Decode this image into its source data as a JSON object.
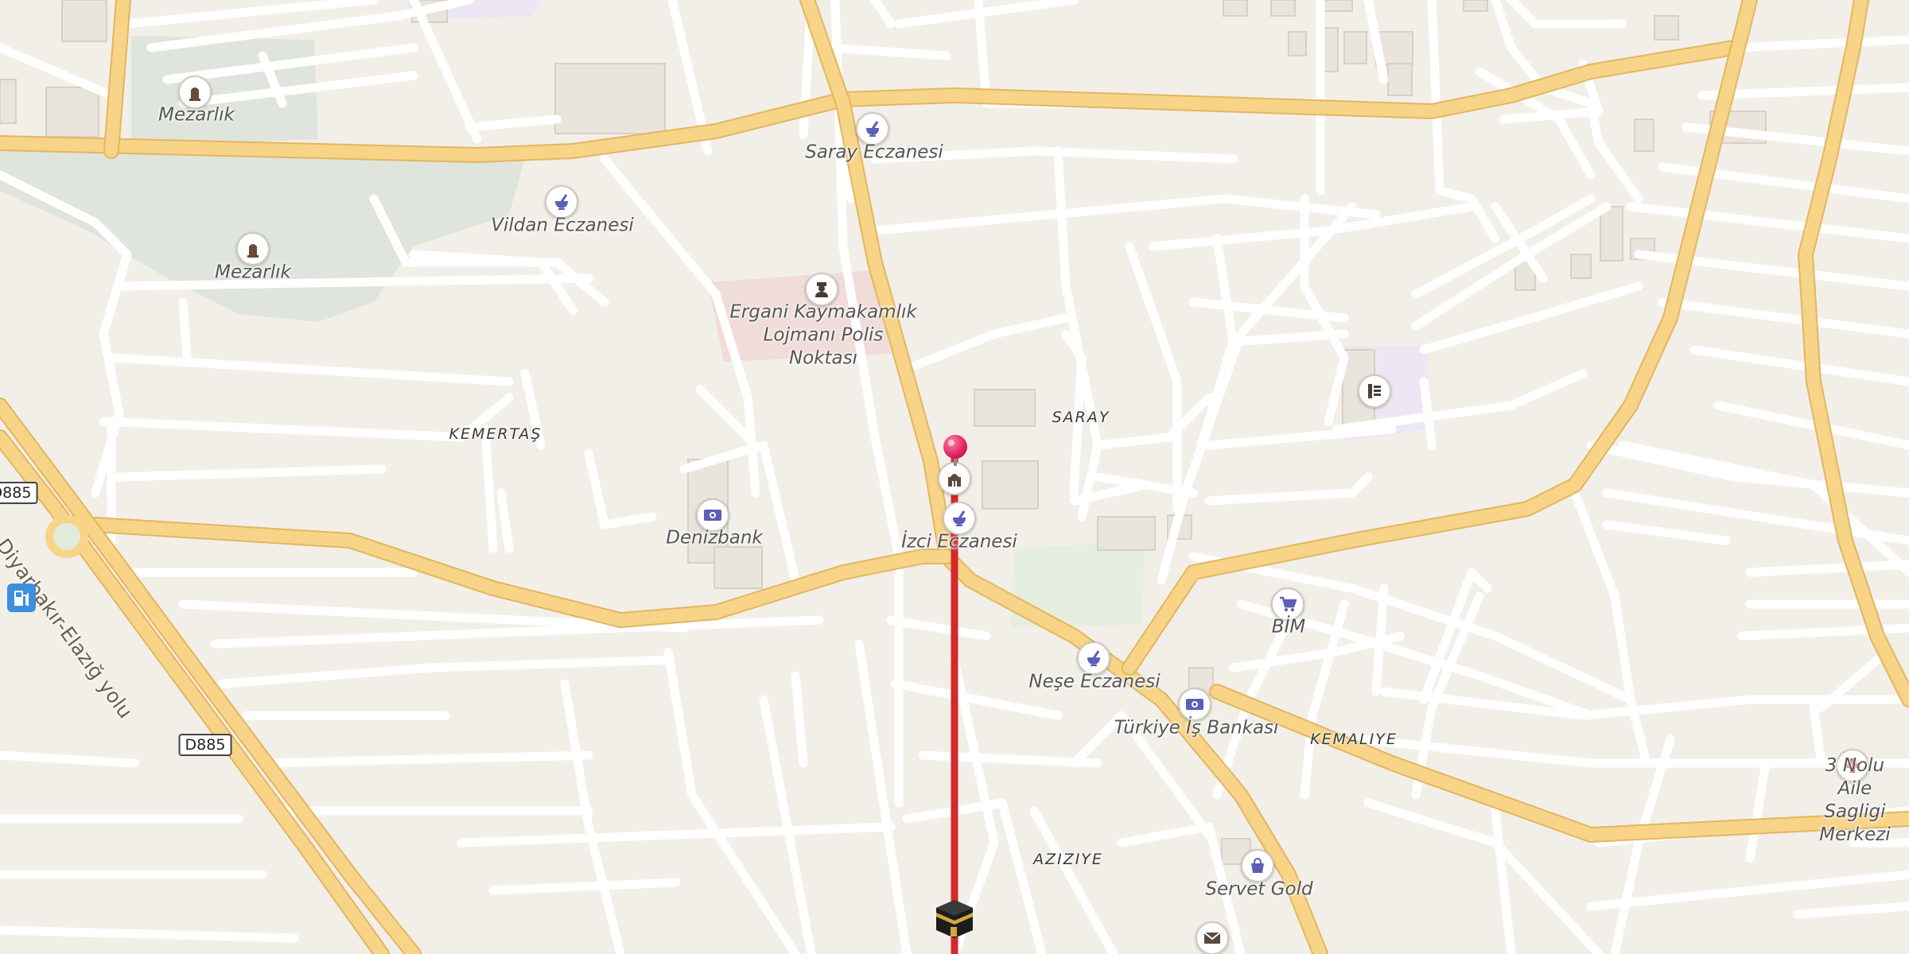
{
  "map": {
    "districts": {
      "kemertas": "KEMERTAŞ",
      "saray": "SARAY",
      "kemaliye": "KEMALIYE",
      "aziziye": "AZIZIYE"
    },
    "road_label": "Diyarbakır-Elazığ yolu",
    "shields": {
      "top": "D885",
      "bottom": "D885"
    },
    "places": {
      "cemetery_1": "Mezarlık",
      "cemetery_2": "Mezarlık",
      "saray_eczanesi": "Saray Eczanesi",
      "vildan_eczanesi": "Vildan Eczanesi",
      "police": "Ergani Kaymakamlık\nLojmanı Polis\nNoktası",
      "denizbank": "Denizbank",
      "izci_eczanesi": "İzci Eczanesi",
      "bim": "BİM",
      "nese_eczanesi": "Neşe Eczanesi",
      "turkiye_is_bankasi": "Türkiye İş Bankası",
      "health_center": "3 Nolu Aile\nSagligi Merkezi",
      "servet_gold": "Servet Gold"
    },
    "icons": {
      "pharmacy": "mortar-pestle-icon",
      "bank": "banknote-icon",
      "cemetery": "gravestone-icon",
      "police": "police-officer-icon",
      "supermarket": "shopping-cart-icon",
      "jewelry": "shopping-bag-icon",
      "hospital": "red-cross-icon",
      "school": "school-icon",
      "post": "envelope-icon",
      "mosque": "mosque-icon",
      "fuel": "fuel-pump-icon",
      "qibla": "kaaba-icon",
      "location_pin": "location-pin-icon"
    },
    "colors": {
      "background": "#f2efe9",
      "major_road": "#f7d487",
      "minor_road": "#ffffff",
      "park": "#dfe5dc",
      "qibla_line": "#d32a2a",
      "pin": "#e8175d",
      "poi_icon": "#5b5fb8"
    }
  }
}
